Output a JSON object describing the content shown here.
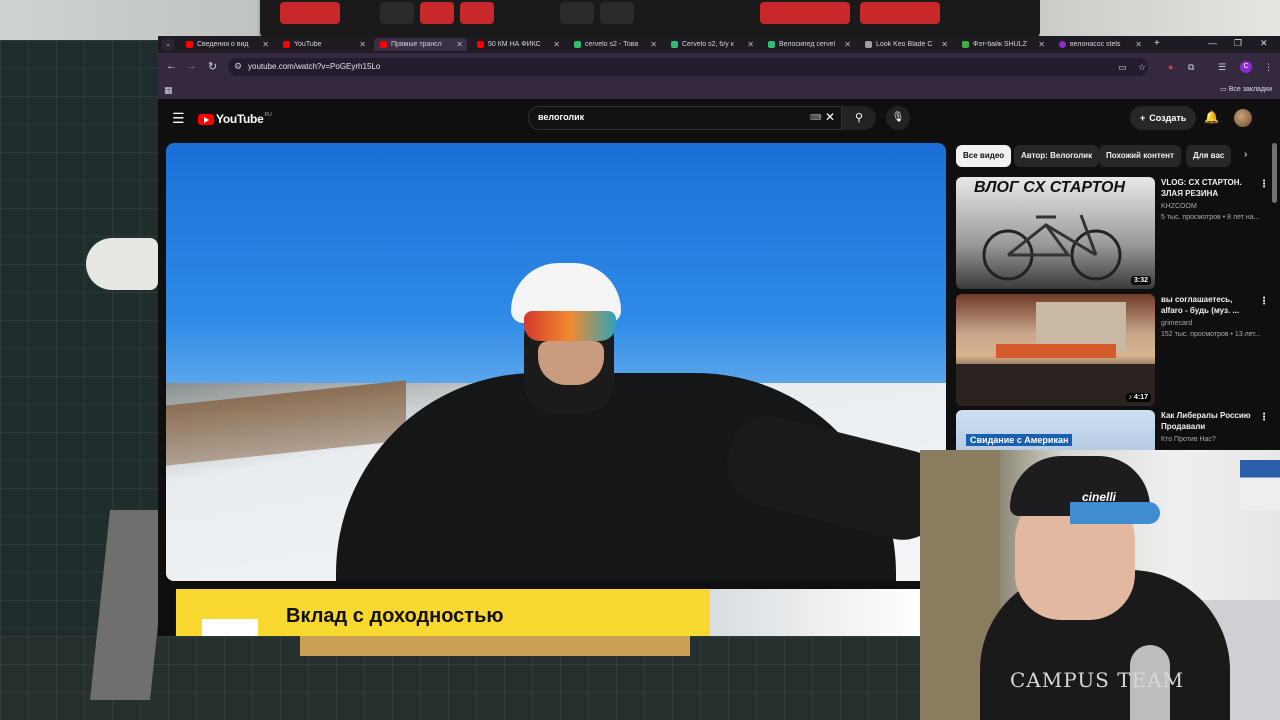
{
  "browser": {
    "tabs": [
      {
        "label": "Сведения о вид",
        "color": "#ff0000",
        "active": false
      },
      {
        "label": "YouTube",
        "color": "#ff0000",
        "active": false
      },
      {
        "label": "Прямые трансл",
        "color": "#ff0000",
        "active": true
      },
      {
        "label": "50 КМ НА ФИКС",
        "color": "#ff0000",
        "active": false
      },
      {
        "label": "cervelo s2 - Това",
        "color": "#2fbf71",
        "active": false
      },
      {
        "label": "Cervelo s2, б/у к",
        "color": "#2fbf71",
        "active": false
      },
      {
        "label": "Велосипед cervel",
        "color": "#2fbf71",
        "active": false
      },
      {
        "label": "Look Keo Blade C",
        "color": "#9e9e9e",
        "active": false
      },
      {
        "label": "Фэт-байк SHULZ",
        "color": "#3cb043",
        "active": false
      },
      {
        "label": "велонасос stels",
        "color": "#8a2bd1",
        "active": false
      }
    ],
    "url": "youtube.com/watch?v=PoGEyrh15Lo",
    "profile_initial": "C",
    "bookmarks_all_label": "Все закладки"
  },
  "youtube": {
    "logo_text": "YouTube",
    "logo_region": "RU",
    "search_query": "велоголик",
    "create_label": "Создать",
    "chips": [
      "Все видео",
      "Автор: Велоголик",
      "Похожий контент",
      "Для вас"
    ],
    "ad_text": "Вклад с доходностью",
    "recommendations": [
      {
        "title": "VLOG: CX СТАРТОН. ЗЛАЯ РЕЗИНА",
        "channel": "KHZCOOM",
        "meta": "5 тыс. просмотров • 8 лет на...",
        "duration": "3:32",
        "thumb_text": "ВЛОГ СХ СТАРТОН"
      },
      {
        "title": "вы соглашаетесь, alfaro - будь (муз. ...",
        "channel": "grimecard",
        "meta": "152 тыс. просмотров • 13 лет...",
        "duration": "♪ 4:17"
      },
      {
        "title": "Как Либералы Россию Продавали",
        "channel": "Кто Против Нас?",
        "meta": "",
        "thumb_text": "Свидание с Американ"
      }
    ]
  },
  "webcam": {
    "shirt_text": "CAMPUS TEAM",
    "cap_text": "cinelli"
  },
  "colors": {
    "youtube_red": "#ff0000",
    "tabstrip": "#1f1b23",
    "toolbar": "#35293f",
    "yt_background": "#0f0f0f",
    "ad_yellow": "#f9d82f"
  }
}
